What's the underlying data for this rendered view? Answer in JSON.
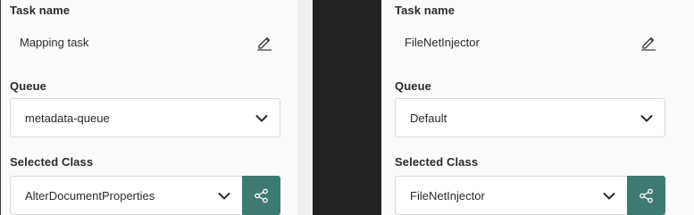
{
  "left": {
    "task_name_label": "Task name",
    "task_name_value": "Mapping task",
    "queue_label": "Queue",
    "queue_value": "metadata-queue",
    "class_label": "Selected Class",
    "class_value": "AlterDocumentProperties"
  },
  "right": {
    "task_name_label": "Task name",
    "task_name_value": "FileNetInjector",
    "queue_label": "Queue",
    "queue_value": "Default",
    "class_label": "Selected Class",
    "class_value": "FileNetInjector"
  },
  "icons": {
    "edit": "pencil-icon",
    "dropdown": "chevron-down-icon",
    "share": "share-icon"
  },
  "colors": {
    "accent": "#3c7a72",
    "panel_bg": "#fcfbfc",
    "divider_bg": "#222222"
  }
}
